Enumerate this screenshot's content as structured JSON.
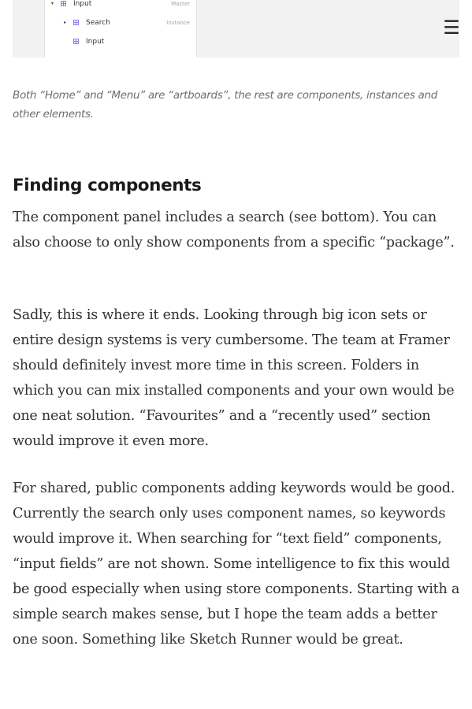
{
  "figure": {
    "layers": [
      {
        "name": "Input",
        "tag": "Master",
        "indent": 0,
        "arrow": "▾"
      },
      {
        "name": "Search",
        "tag": "Instance",
        "indent": 1,
        "arrow": "▸"
      },
      {
        "name": "Input",
        "tag": "",
        "indent": 1,
        "arrow": ""
      }
    ]
  },
  "header": {
    "menu_icon": "hamburger-menu-icon",
    "menu_glyph": "☰"
  },
  "caption": "Both “Home” and “Menu” are “artboards”, the rest are components, instances and other elements.",
  "section": {
    "heading": "Finding components",
    "paragraphs": [
      "The component panel includes a search (see bottom). You can also choose to only show components from a specific “package”.",
      "Sadly, this is where it ends. Looking through big icon sets or entire design systems is very cumbersome. The team at Framer should definitely invest more time in this screen. Folders in which you can mix installed components and your own would be one neat solution. “Favourites” and a “recently used” section would improve it even more.",
      "For shared, public components adding keywords would be good. Currently the search only uses component names, so keywords would improve it. When searching for “text field” components, “input fields” are not shown. Some intelligence to fix this would be good especially when using store components. Starting with a simple search makes sense, but I hope the team adds a better one soon. Something like Sketch Runner would be great."
    ]
  }
}
